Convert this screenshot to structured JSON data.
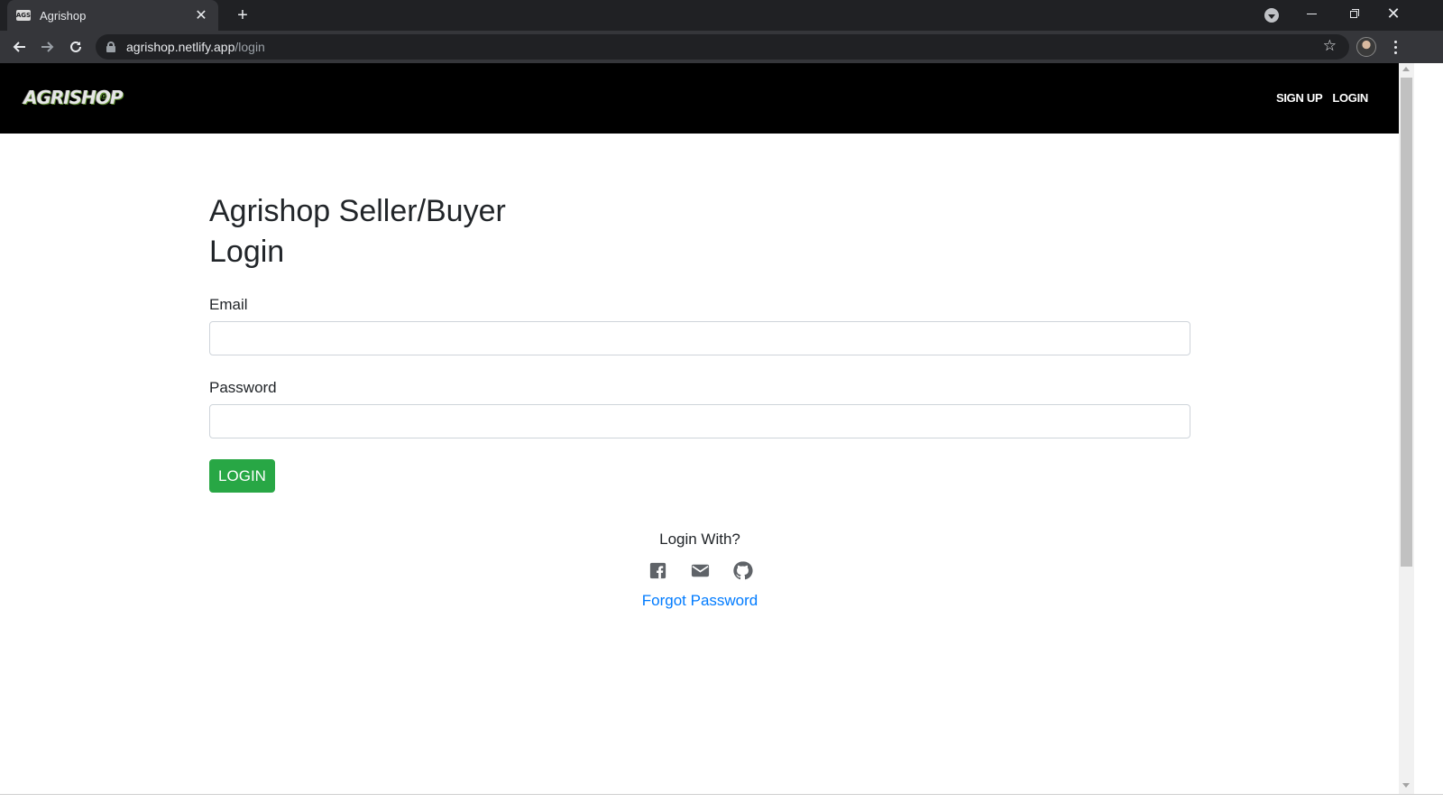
{
  "browser": {
    "tab_title": "Agrishop",
    "favicon_text": "AGS",
    "url_host": "agrishop.netlify.app",
    "url_path": "/login",
    "icons": [
      "close-icon",
      "plus-icon",
      "back-arrow-icon",
      "forward-arrow-icon",
      "reload-icon",
      "lock-icon",
      "star-icon",
      "kebab-menu-icon"
    ]
  },
  "site": {
    "logo_text": "AGRISHOP",
    "logo_mark": "®",
    "nav": {
      "signup": "SIGN UP",
      "login": "LOGIN"
    }
  },
  "login_form": {
    "heading_line1": "Agrishop Seller/Buyer",
    "heading_line2": "Login",
    "email_label": "Email",
    "email_value": "",
    "password_label": "Password",
    "password_value": "",
    "submit_label": "LOGIN",
    "submit_color": "#28a745"
  },
  "social_login": {
    "title": "Login With?",
    "icons": [
      "facebook-icon",
      "email-icon",
      "github-icon"
    ],
    "forgot_password": "Forgot Password",
    "link_color": "#007bff"
  }
}
